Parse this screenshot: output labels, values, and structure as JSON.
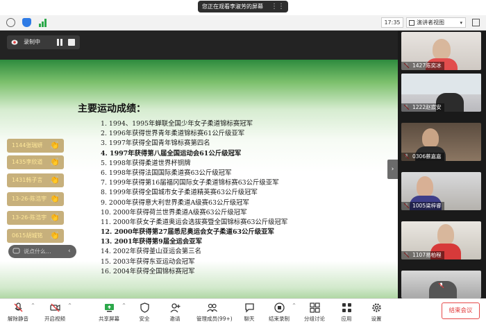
{
  "share_banner": {
    "text": "您正在观看李淑芳的屏幕",
    "more": "⋮⋮"
  },
  "toolbar": {
    "time": "17:35",
    "view_mode": "演讲者视图"
  },
  "recording": {
    "label": "录制中"
  },
  "slide": {
    "title": "主要运动成绩：",
    "items": [
      "1. 1994、1995年蝉联全国少年女子柔道锦标赛冠军",
      "2. 1996年获得世界青年柔道锦标赛61公斤级亚军",
      "3. 1997年获得全国青年锦标赛第四名",
      "4. 1997年获得第八届全国运动会61公斤级冠军",
      "5. 1998年获得柔道世界杯铜牌",
      "6. 1998年获得法国国际柔道赛63公斤级冠军",
      "7. 1999年获得第16届福冈国际女子柔道锦标赛63公斤级亚军",
      "8. 1999年获得全国城市女子柔道精英赛63公斤级冠军",
      "9. 2000年获得意大利世界柔道A级赛63公斤级冠军",
      "10. 2000年获得荷兰世界柔道A级赛63公斤级冠军",
      "11. 2000年获女子柔道奥运会选拔赛暨全国锦标赛63公斤级冠军",
      "12. 2000年获得第27届悉尼奥运会女子柔道63公斤级亚军",
      "13. 2001年获得第9届全运会亚军",
      "14. 2002年获得釜山亚运会第三名",
      "15. 2003年获得东亚运动会冠军",
      "16. 2004年获得全国锦标赛冠军"
    ]
  },
  "reactions": [
    {
      "name": "1144张瑞妍",
      "emoji": "👏"
    },
    {
      "name": "1435李欣道",
      "emoji": "👏"
    },
    {
      "name": "1431韩子言",
      "emoji": "👏"
    },
    {
      "name": "13-26-陈浩宇",
      "emoji": "👏"
    },
    {
      "name": "13-26-陈浩宇",
      "emoji": "👏"
    },
    {
      "name": "0615胡城铭",
      "emoji": "👏"
    }
  ],
  "chat_input": {
    "placeholder": "说点什么...",
    "arrow": "‹"
  },
  "collapse": "›",
  "participants": [
    {
      "name": "1427陈奕冰"
    },
    {
      "name": "1222赵宸安"
    },
    {
      "name": "0306蔡嘉嘉"
    },
    {
      "name": "1005梁梓睿"
    },
    {
      "name": "1107易柏程"
    },
    {
      "name": ""
    }
  ],
  "controls": {
    "mute": "解除静音",
    "video": "开启视频",
    "share": "共享屏幕",
    "security": "安全",
    "invite": "邀请",
    "members": "管理成员(99+)",
    "chat": "聊天",
    "record": "结束录制",
    "breakout": "分组讨论",
    "apps": "应用",
    "settings": "设置",
    "end": "结束会议"
  },
  "colors": {
    "accent_red": "#e23b3b",
    "slide_green": "#2e8b3e",
    "react_bg": "#b4965a"
  }
}
